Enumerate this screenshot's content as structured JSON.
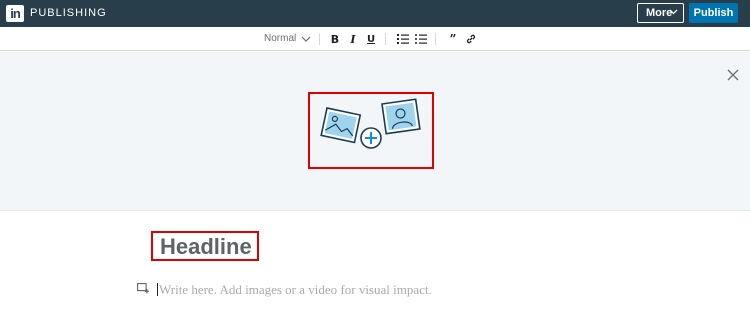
{
  "header": {
    "logo_text": "in",
    "brand_label": "PUBLISHING",
    "more_label": "More",
    "publish_label": "Publish",
    "background": "#283e4a",
    "publish_color": "#0073b1"
  },
  "toolbar": {
    "style_select_value": "Normal",
    "bold_label": "B",
    "italic_label": "I",
    "underline_label": "U",
    "quote_label": "”",
    "icons": [
      "chevron-down-icon",
      "numbered-list-icon",
      "bulleted-list-icon",
      "quote-icon",
      "link-icon"
    ]
  },
  "cover": {
    "icons": [
      "close-icon",
      "landscape-image-icon",
      "add-circle-icon",
      "person-image-icon"
    ],
    "background": "#f3f6f8"
  },
  "editor": {
    "headline_placeholder": "Headline",
    "body_placeholder": "Write here. Add images or a video for visual impact.",
    "media_icon": "add-media-icon"
  },
  "annotations": {
    "highlight_color": "#e00000"
  }
}
